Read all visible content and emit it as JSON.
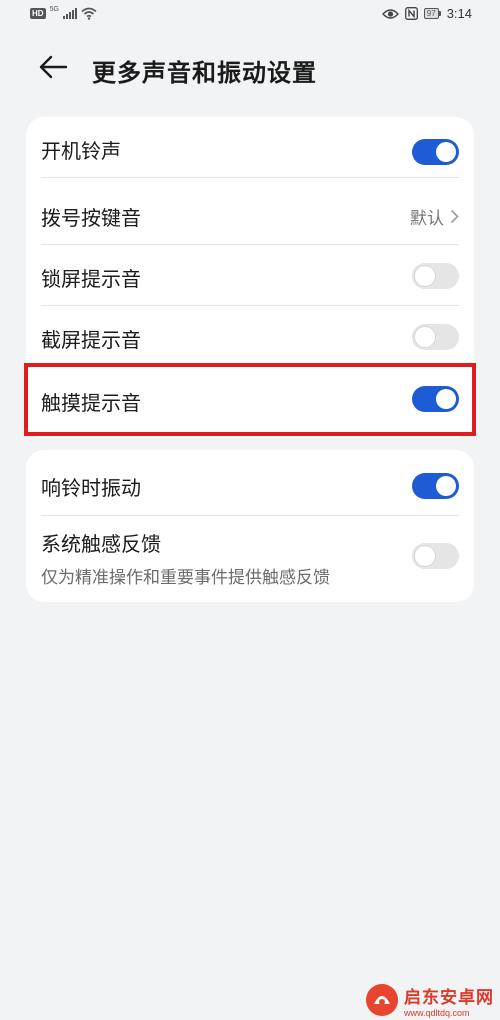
{
  "status_bar": {
    "hd_badge": "HD",
    "network": "5G",
    "battery": "97",
    "time": "3:14"
  },
  "header": {
    "title": "更多声音和振动设置"
  },
  "group1": {
    "items": [
      {
        "label": "开机铃声",
        "toggle": "on"
      },
      {
        "label": "拨号按键音",
        "value": "默认"
      },
      {
        "label": "锁屏提示音",
        "toggle": "off"
      },
      {
        "label": "截屏提示音",
        "toggle": "off"
      },
      {
        "label": "触摸提示音",
        "toggle": "on"
      }
    ]
  },
  "group2": {
    "items": [
      {
        "label": "响铃时振动",
        "toggle": "on"
      },
      {
        "label": "系统触感反馈",
        "sublabel": "仅为精准操作和重要事件提供触感反馈",
        "toggle": "off"
      }
    ]
  },
  "watermark": {
    "title": "启东安卓网",
    "url": "www.qdltdq.com"
  },
  "colors": {
    "accent": "#1e5cd6",
    "highlight_box": "#e01d1d",
    "background": "#f1f3f5"
  }
}
